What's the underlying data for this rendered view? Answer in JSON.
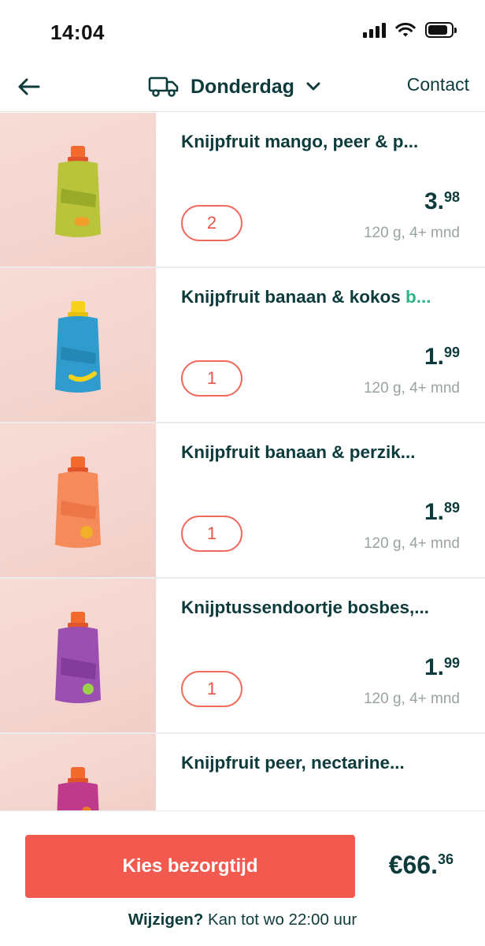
{
  "status_bar": {
    "time": "14:04"
  },
  "header": {
    "back_icon": "arrow-left-icon",
    "truck_icon": "delivery-truck-icon",
    "day": "Donderdag",
    "chevron_icon": "chevron-down-icon",
    "contact": "Contact"
  },
  "products": [
    {
      "name": "Knijpfruit mango, peer & p...",
      "promo": "",
      "qty": "2",
      "price_euros": "3",
      "price_cents": "98",
      "unit": "120 g, 4+ mnd",
      "pouch_color": "#b9c43a",
      "label_color": "#8aa020"
    },
    {
      "name": "Knijpfruit banaan & kokos ",
      "promo": "b...",
      "qty": "1",
      "price_euros": "1",
      "price_cents": "99",
      "unit": "120 g, 4+ mnd",
      "pouch_color": "#2f9ccd",
      "label_color": "#f6d21a"
    },
    {
      "name": "Knijpfruit banaan & perzik...",
      "promo": "",
      "qty": "1",
      "price_euros": "1",
      "price_cents": "89",
      "unit": "120 g, 4+ mnd",
      "pouch_color": "#f58a5a",
      "label_color": "#f0b02a"
    },
    {
      "name": "Knijptussendoortje bosbes,...",
      "promo": "",
      "qty": "1",
      "price_euros": "1",
      "price_cents": "99",
      "unit": "120 g, 4+ mnd",
      "pouch_color": "#9b4fb0",
      "label_color": "#f39b2b"
    },
    {
      "name": "Knijpfruit peer, nectarine...",
      "promo": "",
      "qty": "",
      "price_euros": "",
      "price_cents": "",
      "unit": "",
      "pouch_color": "#c03a8c",
      "label_color": "#f07a2b"
    }
  ],
  "footer": {
    "cta": "Kies bezorgtijd",
    "total_main": "€66.",
    "total_cents": "36",
    "change_bold": "Wijzigen?",
    "change_rest": " Kan tot wo 22:00 uur"
  },
  "colors": {
    "accent": "#f25a4f",
    "text": "#0d3b3c",
    "muted": "#9aa3a3",
    "promo": "#2fb38a"
  }
}
